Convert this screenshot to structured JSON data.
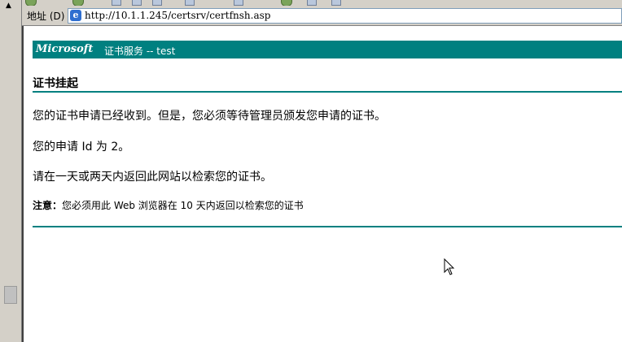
{
  "address_bar": {
    "label": "地址 (D)",
    "url": "http://10.1.1.245/certsrv/certfnsh.asp"
  },
  "banner": {
    "brand": "Microsoft",
    "service": "证书服务 --  test"
  },
  "page": {
    "title": "证书挂起",
    "line1": "您的证书申请已经收到。但是，您必须等待管理员颁发您申请的证书。",
    "line2": "您的申请 Id 为 2。",
    "line3": "请在一天或两天内返回此网站以检索您的证书。",
    "note_label": "注意：",
    "note_text": "您必须用此 Web 浏览器在 10 天内返回以检索您的证书"
  },
  "colors": {
    "accent": "#008080",
    "chrome": "#d4d0c8"
  },
  "icons": {
    "browser": "ie-page-icon",
    "pointer": "mouse-cursor-icon"
  }
}
